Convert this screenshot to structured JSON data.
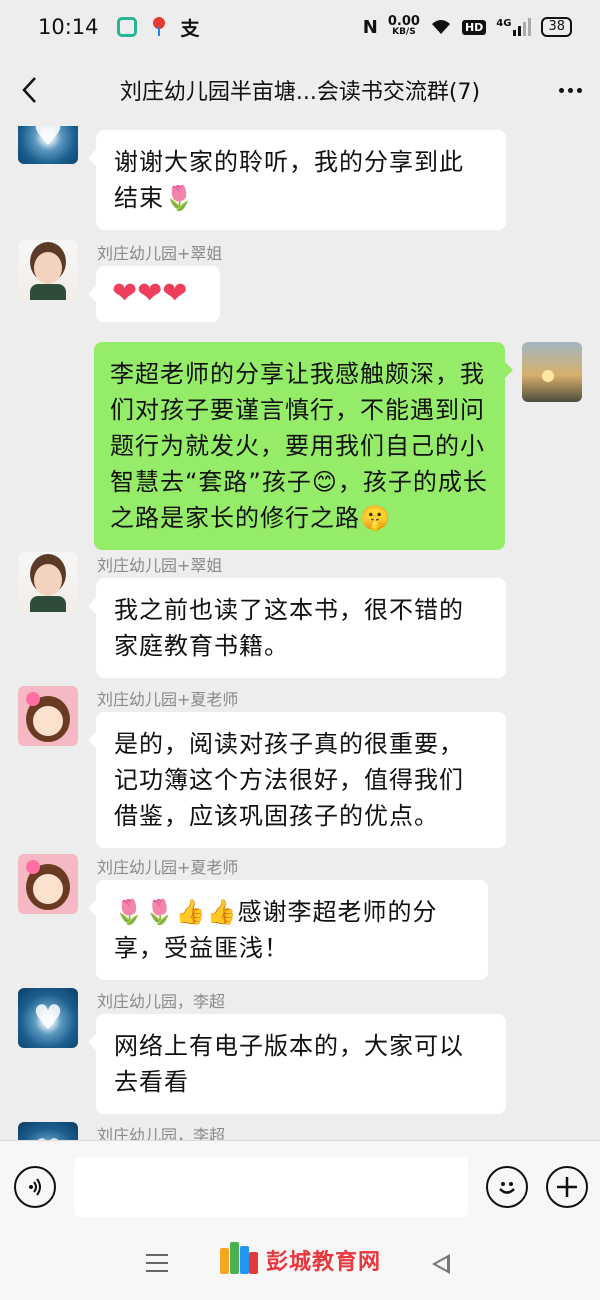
{
  "status_bar": {
    "time": "10:14",
    "alipay_glyph": "支",
    "nfc": "N",
    "net_speed_value": "0.00",
    "net_speed_unit": "KB/S",
    "hd": "HD",
    "network": "4G",
    "battery": "38"
  },
  "header": {
    "title": "刘庄幼儿园半亩塘...会读书交流群(7)"
  },
  "messages": [
    {
      "sender": "",
      "side": "left",
      "avatar": "blue-heart-avatar",
      "text": "谢谢大家的聆听，我的分享到此结束🌷"
    },
    {
      "sender": "刘庄幼儿园+翠姐",
      "side": "left",
      "avatar": "girl-photo-avatar",
      "text": "❤❤❤"
    },
    {
      "sender": "",
      "side": "right",
      "avatar": "sunset-photo-avatar",
      "text": "李超老师的分享让我感触颇深，我们对孩子要谨言慎行，不能遇到问题行为就发火，要用我们自己的小智慧去“套路”孩子😊，孩子的成长之路是家长的修行之路🤫"
    },
    {
      "sender": "刘庄幼儿园+翠姐",
      "side": "left",
      "avatar": "girl-photo-avatar",
      "text": "我之前也读了这本书，很不错的家庭教育书籍。"
    },
    {
      "sender": "刘庄幼儿园+夏老师",
      "side": "left",
      "avatar": "cartoon-girl-avatar",
      "text": "是的，阅读对孩子真的很重要，记功簿这个方法很好，值得我们借鉴，应该巩固孩子的优点。"
    },
    {
      "sender": "刘庄幼儿园+夏老师",
      "side": "left",
      "avatar": "cartoon-girl-avatar",
      "text": "🌷🌷👍👍感谢李超老师的分享，受益匪浅！"
    },
    {
      "sender": "刘庄幼儿园，李超",
      "side": "left",
      "avatar": "blue-heart-avatar",
      "text": "网络上有电子版本的，大家可以去看看"
    },
    {
      "sender": "刘庄幼儿园，李超",
      "side": "left",
      "avatar": "blue-heart-avatar",
      "text": ""
    }
  ],
  "input_bar": {
    "voice_icon": "voice-icon",
    "emoji_icon": "smile-icon",
    "plus_icon": "plus-icon",
    "input_value": ""
  },
  "watermark": {
    "text": "彭城教育网"
  },
  "colors": {
    "background": "#ededed",
    "bubble_self": "#95ec69",
    "bubble_other": "#ffffff",
    "watermark_red": "#e8383d"
  }
}
